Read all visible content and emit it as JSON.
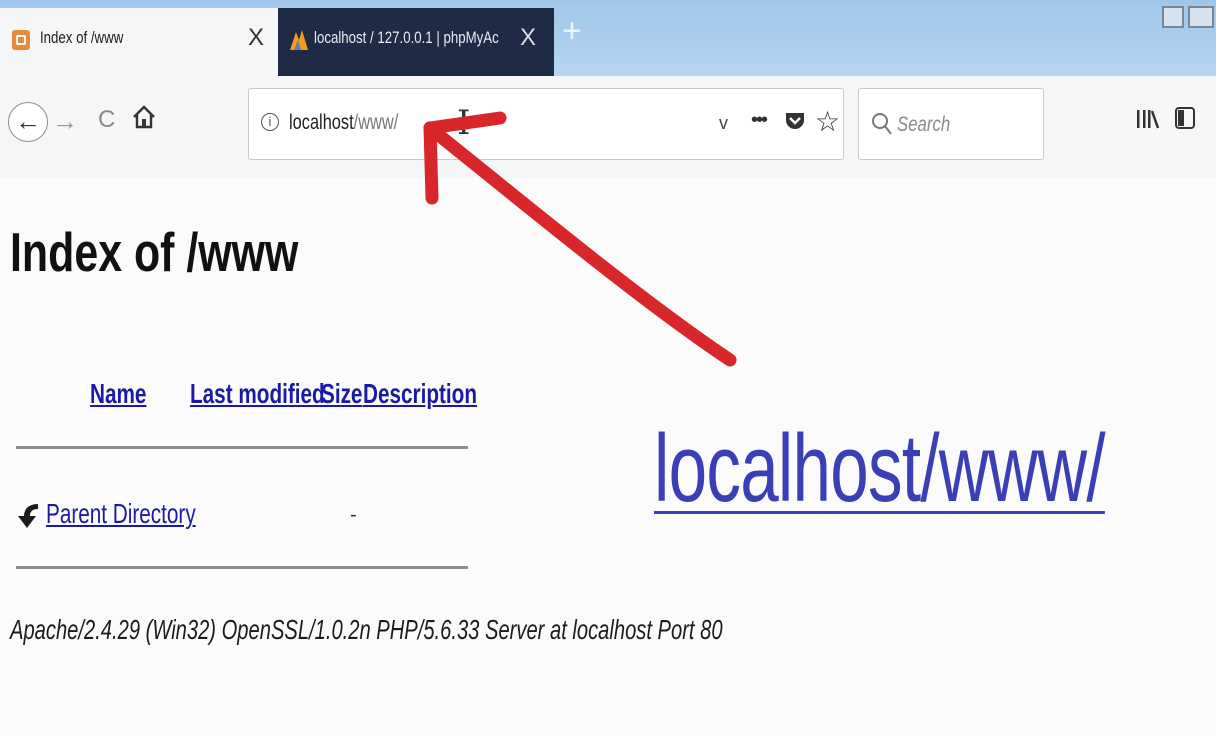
{
  "browser": {
    "tabs": [
      {
        "title": "Index of /www",
        "close": "X",
        "active": true
      },
      {
        "title": "localhost / 127.0.0.1 | phpMyAc",
        "close": "X",
        "active": false
      }
    ],
    "new_tab": "+",
    "nav": {
      "back": "←",
      "forward": "→",
      "reload": "C"
    },
    "url": {
      "info": "i",
      "host": "localhost",
      "path": "/www/",
      "dropdown": "v",
      "more": "•••",
      "star": "☆"
    },
    "search": {
      "placeholder": "Search"
    }
  },
  "page": {
    "title": "Index of /www",
    "columns": {
      "name": "Name",
      "last_modified": "Last modified",
      "size": "Size",
      "description": "Description"
    },
    "rows": [
      {
        "name": "Parent Directory",
        "size": "-"
      }
    ],
    "server_signature": "Apache/2.4.29 (Win32) OpenSSL/1.0.2n PHP/5.6.33 Server at localhost Port 80"
  },
  "annotation": {
    "overlay_text": "localhost/www/",
    "overlay_color": "#3b3fb6",
    "arrow_color": "#d9262a"
  }
}
